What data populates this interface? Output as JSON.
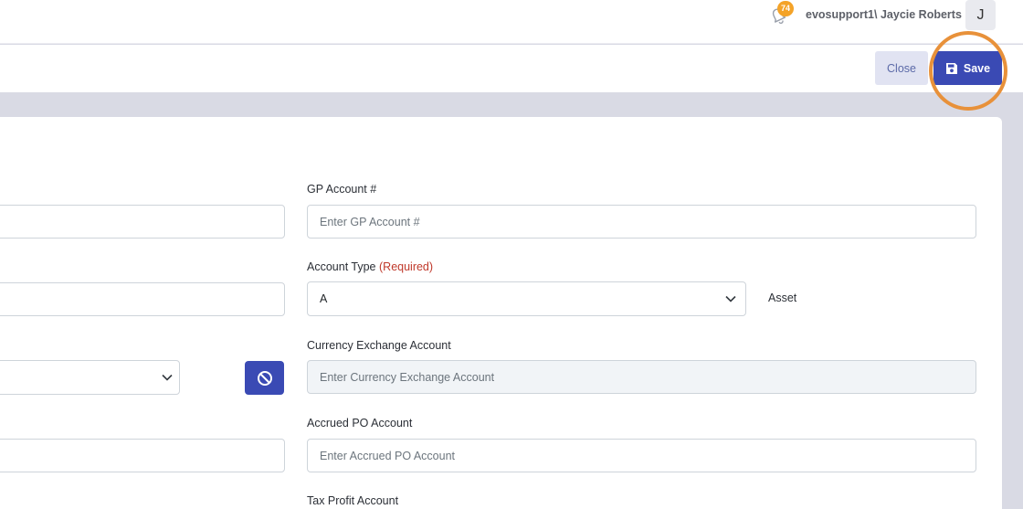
{
  "header": {
    "notification_count": "74",
    "user_name": "evosupport1\\ Jaycie Roberts",
    "avatar_initial": "J"
  },
  "toolbar": {
    "close_label": "Close",
    "save_label": "Save"
  },
  "form": {
    "gp_account": {
      "label": "GP Account #",
      "placeholder": "Enter GP Account #"
    },
    "account_type": {
      "label": "Account Type",
      "required_text": "(Required)",
      "value": "A",
      "description": "Asset"
    },
    "currency_exchange": {
      "label": "Currency Exchange Account",
      "placeholder": "Enter Currency Exchange Account"
    },
    "accrued_po": {
      "label": "Accrued PO Account",
      "placeholder": "Enter Accrued PO Account"
    },
    "tax_profit": {
      "label": "Tax Profit Account"
    }
  },
  "colors": {
    "primary": "#3a4ab4",
    "highlight": "#e8913a",
    "badge": "#f4a328",
    "required": "#c0392b"
  }
}
